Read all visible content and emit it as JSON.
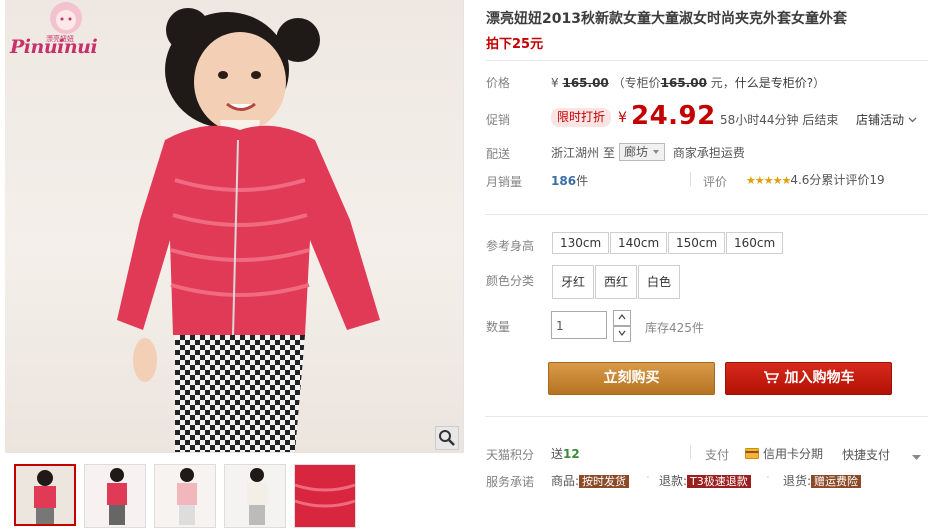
{
  "product": {
    "title": "漂亮妞妞2013秋新款女童大童淑女时尚夹克外套女童外套",
    "subtitle": "拍下25元"
  },
  "brand_logo": {
    "text": "Pinuinui",
    "cn": "漂亮妞妞"
  },
  "price": {
    "label": "价格",
    "currency": "¥",
    "original": "165.00",
    "counter_note_prefix": "（专柜价",
    "counter_price": "165.00",
    "counter_note_suffix": "元，",
    "counter_link": "什么是专柜价?",
    "counter_close": "）"
  },
  "promotion": {
    "label": "促销",
    "tag": "限时打折",
    "currency": "¥",
    "price": "24.92",
    "countdown": "58小时44分钟 后结束",
    "store_activity": "店铺活动"
  },
  "shipping": {
    "label": "配送",
    "from": "浙江湖州",
    "to_word": "至",
    "destination": "廊坊",
    "fee_note": "商家承担运费"
  },
  "sales": {
    "label": "月销量",
    "count": "186",
    "unit": "件",
    "rating_label": "评价",
    "stars": "★★★★★",
    "score_text": "4.6分",
    "review_text": "累计评价19"
  },
  "sizes": {
    "label": "参考身高",
    "options": [
      "130cm",
      "140cm",
      "150cm",
      "160cm"
    ]
  },
  "colors": {
    "label": "颜色分类",
    "options": [
      "牙红",
      "西红",
      "白色"
    ]
  },
  "quantity": {
    "label": "数量",
    "value": "1",
    "stock": "库存425件"
  },
  "buttons": {
    "buy_now": "立刻购买",
    "add_cart": "加入购物车"
  },
  "points": {
    "label": "天猫积分",
    "prefix": "送",
    "value": "12",
    "pay_label": "支付",
    "card_pay": "信用卡分期",
    "quick_pay": "快捷支付"
  },
  "service": {
    "label": "服务承诺",
    "items": [
      {
        "prefix": "商品:",
        "badge": "按时发货"
      },
      {
        "prefix": "退款:",
        "badge": "T3极速退款"
      },
      {
        "prefix": "退货:",
        "badge": "赠运费险"
      }
    ]
  },
  "colors_theme": {
    "accent_red": "#c40000",
    "buy_button": "#c9862f",
    "cart_button": "#c81e12"
  }
}
